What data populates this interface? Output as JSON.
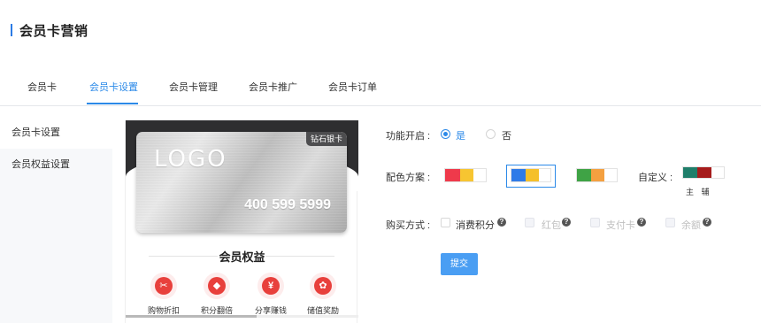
{
  "page": {
    "title": "会员卡营销",
    "accent": "#2c8ae8"
  },
  "tabs": [
    {
      "label": "会员卡"
    },
    {
      "label": "会员卡设置",
      "active": true
    },
    {
      "label": "会员卡管理"
    },
    {
      "label": "会员卡推广"
    },
    {
      "label": "会员卡订单"
    }
  ],
  "sidebar": {
    "items": [
      {
        "label": "会员卡设置",
        "active": true
      },
      {
        "label": "会员权益设置"
      }
    ]
  },
  "preview": {
    "card": {
      "badge": "钻石银卡",
      "logo": "LOGO",
      "phone": "400 599 5999"
    },
    "benefits_title": "会员权益",
    "benefits": [
      {
        "label": "购物折扣",
        "icon": "discount-ticket-icon",
        "glyph": "✂"
      },
      {
        "label": "积分翻倍",
        "icon": "points-double-icon",
        "glyph": "◆"
      },
      {
        "label": "分享赚钱",
        "icon": "money-bag-icon",
        "glyph": "¥"
      },
      {
        "label": "储值奖励",
        "icon": "piggy-bank-icon",
        "glyph": "✿"
      }
    ]
  },
  "form": {
    "enable": {
      "label": "功能开启 :",
      "options": [
        {
          "label": "是",
          "checked": true
        },
        {
          "label": "否",
          "checked": false
        }
      ]
    },
    "color_scheme": {
      "label": "配色方案 :",
      "schemes": [
        {
          "colors": [
            "#ef3a4b",
            "#f7c531"
          ],
          "selected": false
        },
        {
          "colors": [
            "#2f7be8",
            "#f5c02a"
          ],
          "selected": true
        },
        {
          "colors": [
            "#3fa345",
            "#f4a040"
          ],
          "selected": false
        }
      ],
      "custom_label": "自定义 :",
      "custom_colors": [
        "#1f7e6a",
        "#a61c1c"
      ],
      "custom_caption": "主 辅"
    },
    "purchase": {
      "label": "购买方式 :",
      "options": [
        {
          "label": "消费积分",
          "disabled": false
        },
        {
          "label": "红包",
          "disabled": true
        },
        {
          "label": "支付卡",
          "disabled": true
        },
        {
          "label": "余额",
          "disabled": true
        }
      ]
    },
    "submit_label": "提交"
  }
}
